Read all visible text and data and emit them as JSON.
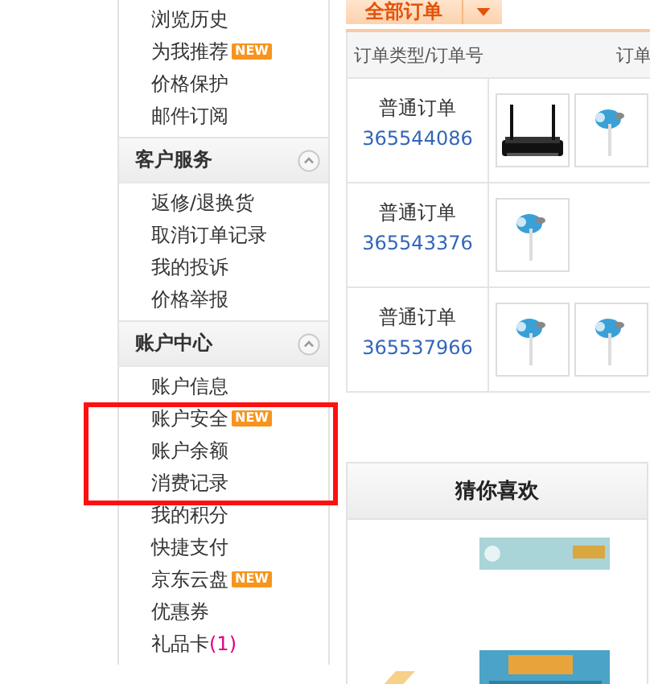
{
  "sidebar": {
    "sections": [
      {
        "items": [
          {
            "label": "浏览历史"
          },
          {
            "label": "为我推荐",
            "badge": "NEW"
          },
          {
            "label": "价格保护"
          },
          {
            "label": "邮件订阅"
          }
        ]
      },
      {
        "title": "客户服务",
        "expanded": true,
        "items": [
          {
            "label": "返修/退换货"
          },
          {
            "label": "取消订单记录"
          },
          {
            "label": "我的投诉"
          },
          {
            "label": "价格举报"
          }
        ]
      },
      {
        "title": "账户中心",
        "expanded": true,
        "items": [
          {
            "label": "账户信息"
          },
          {
            "label": "账户安全",
            "badge": "NEW"
          },
          {
            "label": "账户余额"
          },
          {
            "label": "消费记录"
          },
          {
            "label": "我的积分"
          },
          {
            "label": "快捷支付"
          },
          {
            "label": "京东云盘",
            "badge": "NEW"
          },
          {
            "label": "优惠券"
          },
          {
            "label": "礼品卡",
            "count": "(1)"
          }
        ]
      }
    ]
  },
  "orders": {
    "filter_tab": "全部订单",
    "columns": [
      "订单类型/订单号",
      "订单"
    ],
    "rows": [
      {
        "type": "普通订单",
        "number": "365544086"
      },
      {
        "type": "普通订单",
        "number": "365543376"
      },
      {
        "type": "普通订单",
        "number": "365537966"
      }
    ]
  },
  "recommend": {
    "title": "猜你喜欢"
  }
}
